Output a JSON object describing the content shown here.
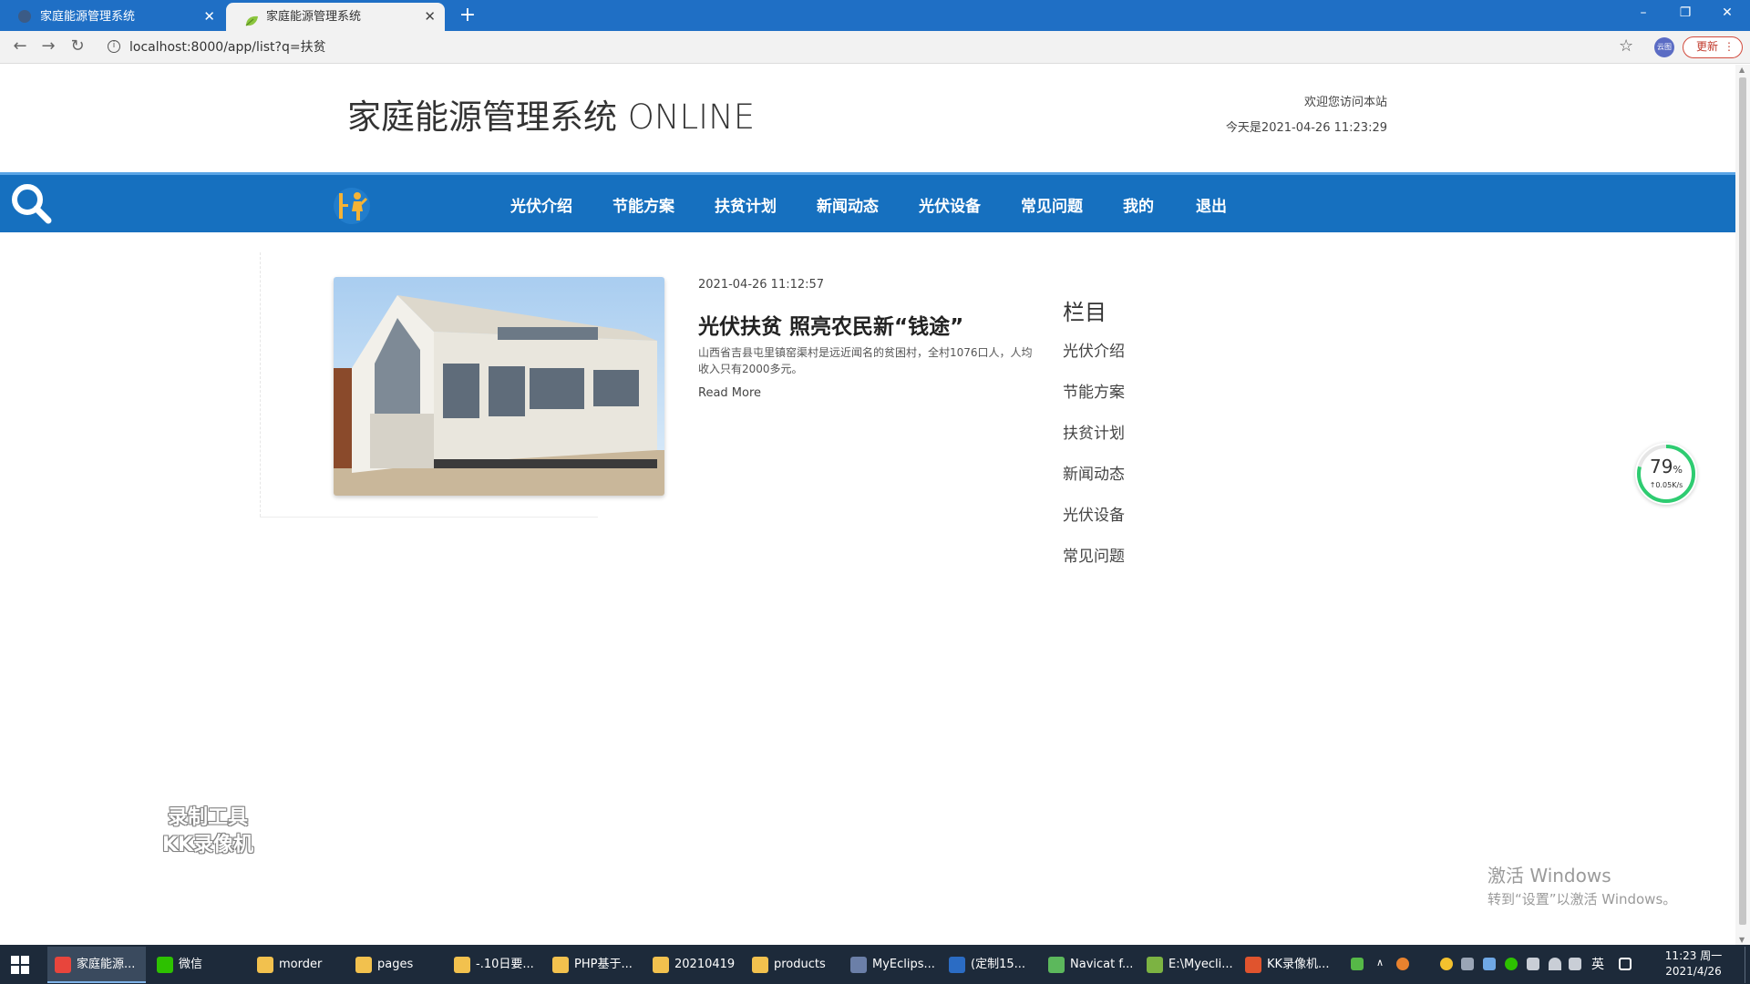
{
  "browser": {
    "tabs": [
      {
        "title": "家庭能源管理系统",
        "active": false
      },
      {
        "title": "家庭能源管理系统",
        "active": true
      }
    ],
    "new_tab": "+",
    "address": "localhost:8000/app/list?q=扶贫",
    "profile_label": "云图",
    "update_label": "更新",
    "update_menu": "⋮",
    "window_controls": {
      "minimize": "–",
      "restore": "❐",
      "close": "✕"
    }
  },
  "site": {
    "title": "家庭能源管理系统 ONLINE",
    "welcome": "欢迎您访问本站",
    "today": "今天是2021-04-26 11:23:29"
  },
  "nav": {
    "items": [
      {
        "label": "光伏介绍"
      },
      {
        "label": "节能方案"
      },
      {
        "label": "扶贫计划"
      },
      {
        "label": "新闻动态"
      },
      {
        "label": "光伏设备"
      },
      {
        "label": "常见问题"
      },
      {
        "label": "我的"
      },
      {
        "label": "退出"
      }
    ]
  },
  "article": {
    "date": "2021-04-26 11:12:57",
    "title": "光伏扶贫 照亮农民新“钱途”",
    "summary": "山西省吉县屯里镇窑渠村是远近闻名的贫困村，全村1076口人，人均收入只有2000多元。",
    "read_more": "Read More"
  },
  "categories": {
    "title": "栏目",
    "items": [
      "光伏介绍",
      "节能方案",
      "扶贫计划",
      "新闻动态",
      "光伏设备",
      "常见问题"
    ]
  },
  "speed_widget": {
    "percent": "79",
    "percent_unit": "%",
    "rate": "↑0.05K/s",
    "fraction": 0.79
  },
  "overlays": {
    "watermark_line1": "录制工具",
    "watermark_line2": "KK录像机",
    "activate_line1": "激活 Windows",
    "activate_line2": "转到“设置”以激活 Windows。"
  },
  "taskbar": {
    "items": [
      {
        "label": "家庭能源...",
        "active": true,
        "color": "#e8453c"
      },
      {
        "label": "微信",
        "active": false,
        "color": "#2dc100"
      },
      {
        "label": "morder",
        "active": false,
        "color": "#f2c14e"
      },
      {
        "label": "pages",
        "active": false,
        "color": "#f2c14e"
      },
      {
        "label": "-.10日要...",
        "active": false,
        "color": "#f2c14e"
      },
      {
        "label": "PHP基于...",
        "active": false,
        "color": "#f2c14e"
      },
      {
        "label": "20210419",
        "active": false,
        "color": "#f2c14e"
      },
      {
        "label": "products",
        "active": false,
        "color": "#f2c14e"
      },
      {
        "label": "MyEclips...",
        "active": false,
        "color": "#6b7fa8"
      },
      {
        "label": "(定制15...",
        "active": false,
        "color": "#2b6cc4"
      },
      {
        "label": "Navicat f...",
        "active": false,
        "color": "#5cb85c"
      },
      {
        "label": "E:\\Myecli...",
        "active": false,
        "color": "#7cb342"
      },
      {
        "label": "KK录像机...",
        "active": false,
        "color": "#e0542e"
      }
    ],
    "ime": "英",
    "clock_time": "11:23 周一",
    "clock_date": "2021/4/26"
  },
  "colors": {
    "tab_strip": "#1f6fc5",
    "nav_bar": "#1670bf",
    "taskbar": "#1d2a3a",
    "speed_ring": "#2ecc71"
  }
}
